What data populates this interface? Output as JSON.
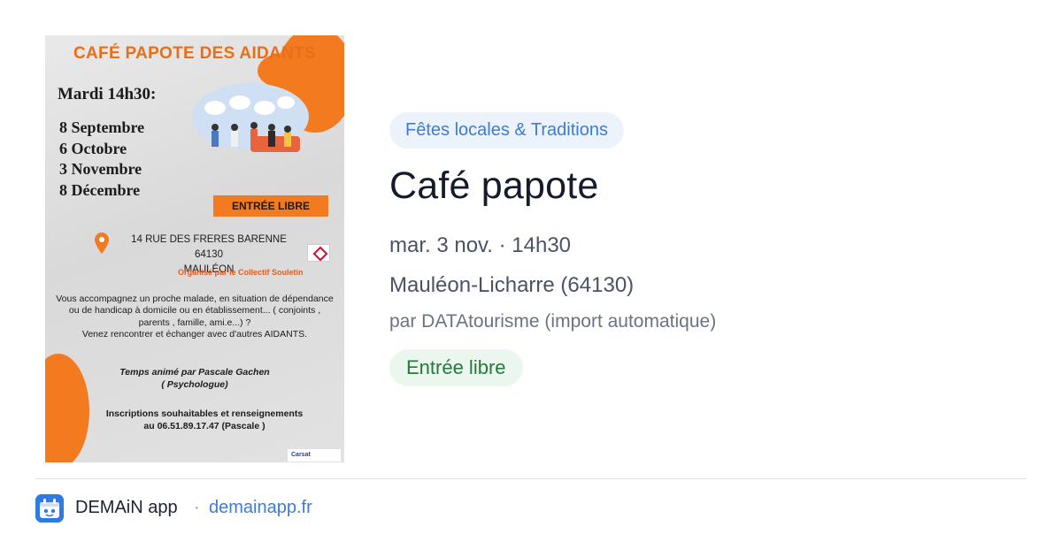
{
  "poster": {
    "title": "CAFÉ PAPOTE DES AIDANTS",
    "time_line": "Mardi 14h30:",
    "dates": [
      "8 Septembre",
      "6 Octobre",
      "3 Novembre",
      "8 Décembre"
    ],
    "free_label": "ENTRÉE LIBRE",
    "address_line1": "14 RUE DES FRERES BARENNE 64130",
    "address_line2": "MAULÉON",
    "organizer": "Organisé par le Collectif Souletin",
    "body_lines": [
      "Vous accompagnez un proche malade, en situation de dépendance",
      "ou de handicap à domicile  ou en établissement... ( conjoints ,",
      "parents , famille, ami.e...) ?",
      "Venez rencontrer et échanger avec d'autres AIDANTS."
    ],
    "animation_lines": [
      "Temps animé par Pascale Gachen",
      "( Psychologue)"
    ],
    "inscription_lines": [
      "Inscriptions souhaitables et renseignements",
      "au 06.51.89.17.47 (Pascale )"
    ],
    "partner_logo": "Carsat"
  },
  "event": {
    "category": "Fêtes locales & Traditions",
    "title": "Café papote",
    "datetime": "mar. 3 nov. · 14h30",
    "location": "Mauléon-Licharre (64130)",
    "source": "par DATAtourisme (import automatique)",
    "price": "Entrée libre"
  },
  "footer": {
    "app_name": "DEMAiN app",
    "separator": "·",
    "domain": "demainapp.fr"
  },
  "colors": {
    "accent_blue": "#3e7bd6",
    "badge_bg": "#edf3fc",
    "price_green": "#237a3b",
    "price_bg": "#ebf7ee",
    "poster_orange": "#f47a1f"
  }
}
